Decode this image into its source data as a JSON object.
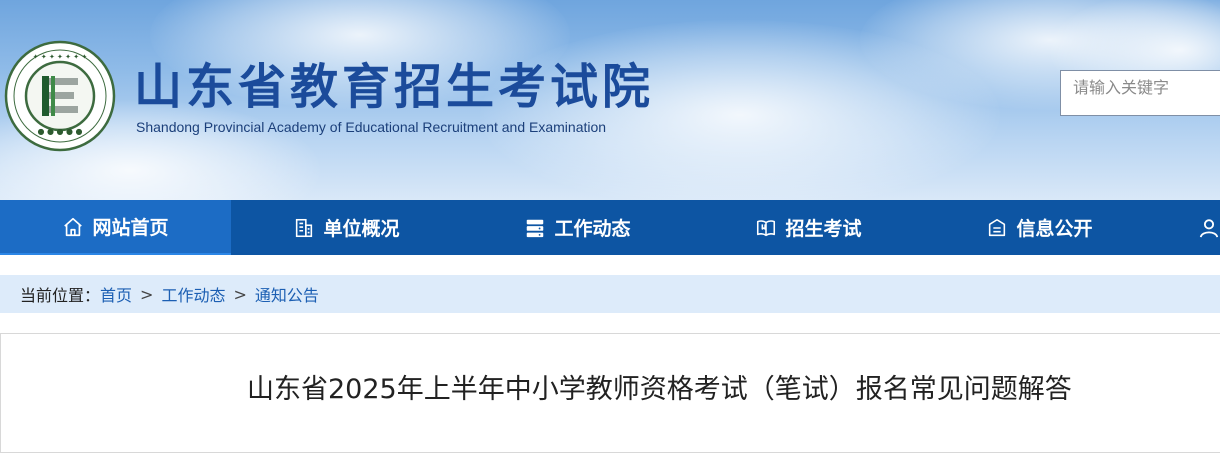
{
  "header": {
    "logo_icon": "school-emblem-icon",
    "title": "山东省教育招生考试院",
    "subtitle": "Shandong Provincial Academy of Educational Recruitment and Examination"
  },
  "search": {
    "placeholder": "请输入关键字"
  },
  "nav": {
    "items": [
      {
        "label": "网站首页",
        "icon": "home-icon",
        "active": true
      },
      {
        "label": "单位概况",
        "icon": "building-icon",
        "active": false
      },
      {
        "label": "工作动态",
        "icon": "server-stack-icon",
        "active": false
      },
      {
        "label": "招生考试",
        "icon": "open-book-icon",
        "active": false
      },
      {
        "label": "信息公开",
        "icon": "notice-board-icon",
        "active": false
      },
      {
        "label": "",
        "icon": "user-icon",
        "active": false
      }
    ]
  },
  "breadcrumb": {
    "prefix": "当前位置：",
    "items": [
      "首页",
      "工作动态",
      "通知公告"
    ],
    "separator": ">"
  },
  "article": {
    "title": "山东省2025年上半年中小学教师资格考试（笔试）报名常见问题解答"
  },
  "colors": {
    "nav_bg": "#0d55a3",
    "nav_active": "#1c6cc5",
    "title_blue": "#1b4b9b",
    "breadcrumb_bg": "#ddebfa",
    "link": "#1c5fb3"
  }
}
